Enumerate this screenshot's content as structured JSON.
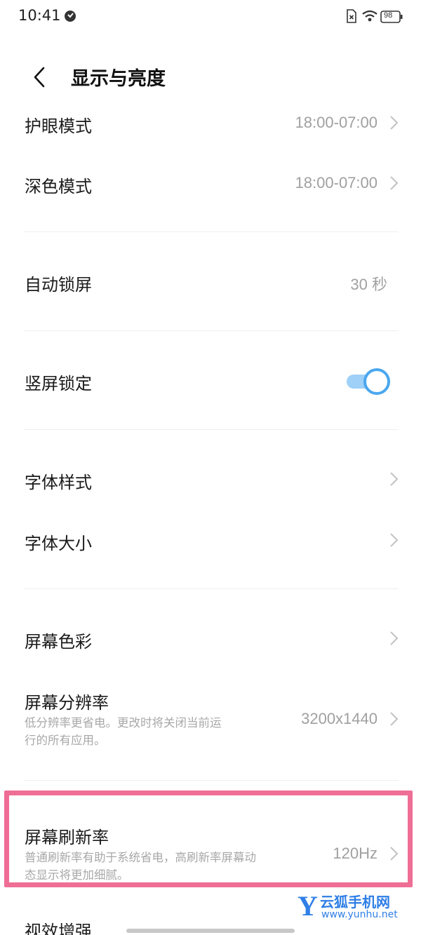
{
  "status_bar": {
    "time": "10:41",
    "battery": "98",
    "icons": [
      "notification-dot-icon",
      "sim-absent-icon",
      "wifi-icon",
      "battery-icon"
    ]
  },
  "header": {
    "title": "显示与亮度",
    "back_icon": "back-arrow-icon"
  },
  "rows": {
    "eye_protection": {
      "label": "护眼模式",
      "value": "18:00-07:00"
    },
    "dark_mode": {
      "label": "深色模式",
      "value": "18:00-07:00"
    },
    "auto_lock": {
      "label": "自动锁屏",
      "value": "30 秒"
    },
    "portrait_lock": {
      "label": "竖屏锁定",
      "enabled": true
    },
    "font_style": {
      "label": "字体样式"
    },
    "font_size": {
      "label": "字体大小"
    },
    "screen_color": {
      "label": "屏幕色彩"
    },
    "resolution": {
      "label": "屏幕分辨率",
      "value": "3200x1440",
      "desc_line1": "低分辨率更省电。更改时将关闭当前运",
      "desc_line2": "行的所有应用。"
    },
    "refresh_rate": {
      "label": "屏幕刷新率",
      "value": "120Hz",
      "desc_line1": "普通刷新率有助于系统省电，高刷新率屏幕动",
      "desc_line2": "态显示将更加细腻。"
    },
    "visual_enhance": {
      "label": "视效增强"
    }
  },
  "colors": {
    "accent": "#4ba7ef",
    "highlight_border": "#ef6e96",
    "watermark": "#2f7fe6"
  },
  "watermark": {
    "logo": "Y",
    "name": "云狐手机网",
    "url": "www.yunhu.net"
  }
}
